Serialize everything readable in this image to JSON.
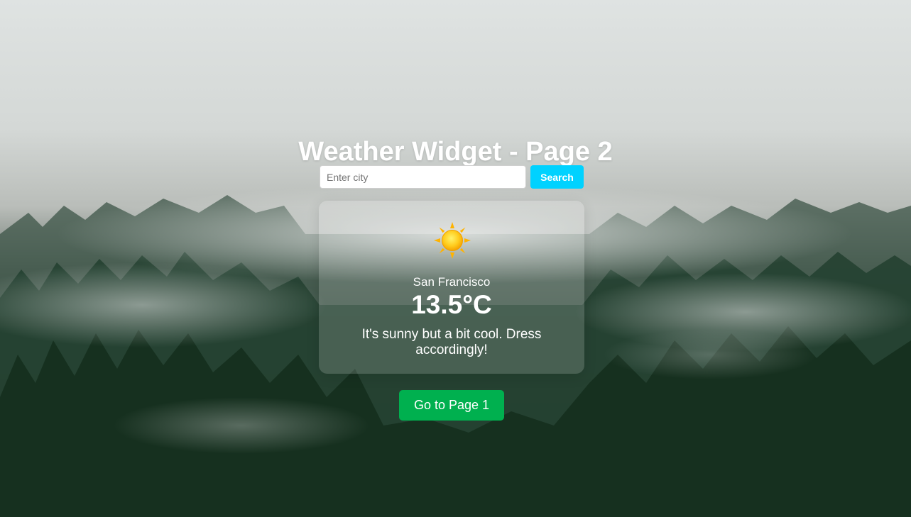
{
  "page": {
    "title": "Weather Widget - Page 2"
  },
  "search": {
    "placeholder": "Enter city",
    "value": "",
    "button_label": "Search"
  },
  "weather": {
    "icon": "sun-icon",
    "city": "San Francisco",
    "temperature": "13.5°C",
    "advice": "It's sunny but a bit cool. Dress accordingly!"
  },
  "navigation": {
    "button_label": "Go to Page 1"
  },
  "colors": {
    "search_button": "#00d2ff",
    "page_button": "#00b04f",
    "text": "#ffffff"
  }
}
